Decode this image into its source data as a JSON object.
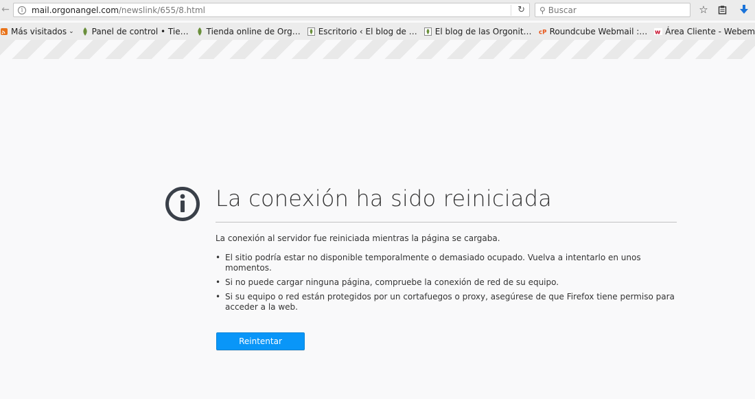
{
  "navbar": {
    "url_host": "mail.orgonangel.com",
    "url_path": "/newslink/655/8.html",
    "search_placeholder": "Buscar"
  },
  "bookmarks": [
    {
      "label": "Más visitados",
      "icon": "rss-icon",
      "icon_color": "#e8731a"
    },
    {
      "label": "Panel de control • Tie…",
      "icon": "leaf-icon",
      "icon_color": "#6a8f3b"
    },
    {
      "label": "Tienda online de Org…",
      "icon": "leaf-icon",
      "icon_color": "#6a8f3b"
    },
    {
      "label": "Escritorio ‹ El blog de …",
      "icon": "doc-icon",
      "icon_color": "#6a8f3b"
    },
    {
      "label": "El blog de las Orgonit…",
      "icon": "doc-icon",
      "icon_color": "#6a8f3b"
    },
    {
      "label": "Roundcube Webmail :…",
      "icon": "cpanel-icon",
      "icon_color": "#e8561a"
    },
    {
      "label": "Área Cliente - Webem…",
      "icon": "webempresa-icon",
      "icon_color": "#c8102e"
    }
  ],
  "error": {
    "title": "La conexión ha sido reiniciada",
    "description": "La conexión al servidor fue reiniciada mientras la página se cargaba.",
    "items": [
      "El sitio podría estar no disponible temporalmente o demasiado ocupado. Vuelva a intentarlo en unos momentos.",
      "Si no puede cargar ninguna página, compruebe la conexión de red de su equipo.",
      "Si su equipo o red están protegidos por un cortafuegos o proxy, asegúrese de que Firefox tiene permiso para acceder a la web."
    ],
    "retry_label": "Reintentar"
  },
  "colors": {
    "accent": "#0996f8",
    "icon_dark": "#3a4049"
  }
}
